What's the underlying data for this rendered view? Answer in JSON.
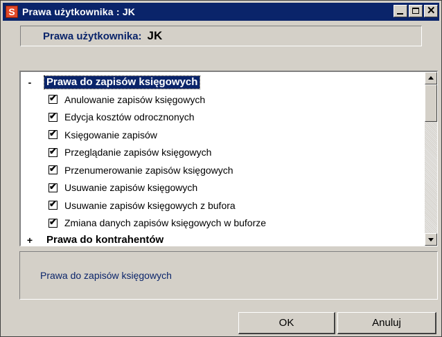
{
  "window": {
    "title": "Prawa użytkownika : JK",
    "icon_letter": "S",
    "icon_color": "#e04828"
  },
  "header": {
    "label": "Prawa użytkownika:",
    "value": "JK"
  },
  "tree": {
    "groups": [
      {
        "expander": "-",
        "label": "Prawa do zapisów księgowych",
        "selected": true,
        "items": [
          {
            "label": "Anulowanie zapisów księgowych",
            "checked": true
          },
          {
            "label": "Edycja kosztów odrocznonych",
            "checked": true
          },
          {
            "label": "Księgowanie zapisów",
            "checked": true
          },
          {
            "label": "Przeglądanie zapisów księgowych",
            "checked": true
          },
          {
            "label": "Przenumerowanie zapisów księgowych",
            "checked": true
          },
          {
            "label": "Usuwanie zapisów księgowych",
            "checked": true
          },
          {
            "label": "Usuwanie zapisów księgowych z bufora",
            "checked": true
          },
          {
            "label": "Zmiana danych zapisów księgowych w buforze",
            "checked": true
          }
        ]
      },
      {
        "expander": "+",
        "label": "Prawa do kontrahentów",
        "selected": false,
        "items": []
      }
    ]
  },
  "description": {
    "text": "Prawa do zapisów księgowych"
  },
  "buttons": {
    "ok_label": "OK",
    "cancel_label": "Anuluj"
  },
  "colors": {
    "titlebar": "#0a246a",
    "face": "#d4d0c8",
    "accent_text": "#0a246a"
  }
}
